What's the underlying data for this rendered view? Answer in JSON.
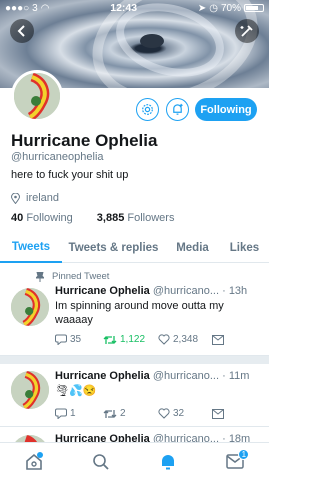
{
  "status_bar": {
    "carrier": "3",
    "time": "12:43",
    "battery": "70%"
  },
  "profile": {
    "name": "Hurricane Ophelia",
    "handle": "@hurricaneophelia",
    "bio": "here to fuck your shit up",
    "location": "ireland",
    "following_count": "40",
    "following_label": "Following",
    "followers_count": "3,885",
    "followers_label": "Followers",
    "follow_button_label": "Following"
  },
  "tabs": [
    "Tweets",
    "Tweets & replies",
    "Media",
    "Likes"
  ],
  "tweets": [
    {
      "pinned_label": "Pinned Tweet",
      "name": "Hurricane Ophelia",
      "handle": "@hurricano...",
      "time": "· 13h",
      "text": "Im spinning around move outta my waaaay",
      "replies": "35",
      "retweets": "1,122",
      "likes": "2,348"
    },
    {
      "name": "Hurricane Ophelia",
      "handle": "@hurricano...",
      "time": "· 11m",
      "text": "🌪💦😒",
      "replies": "1",
      "retweets": "2",
      "likes": "32"
    },
    {
      "name": "Hurricane Ophelia",
      "handle": "@hurricano...",
      "time": "· 18m"
    }
  ],
  "nav": {
    "messages_badge": "1"
  },
  "colors": {
    "accent": "#1da1f2",
    "retweeted": "#17bf63"
  }
}
